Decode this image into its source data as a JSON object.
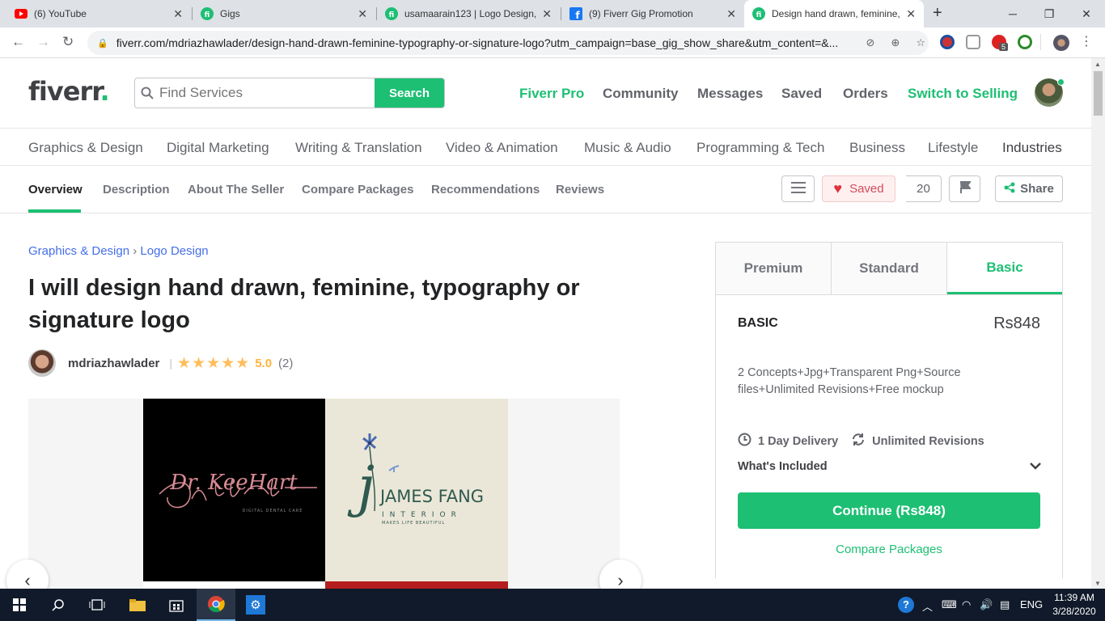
{
  "browser": {
    "tabs": [
      {
        "title": "(6) YouTube",
        "icon": "youtube-icon"
      },
      {
        "title": "Gigs",
        "icon": "fiverr-icon"
      },
      {
        "title": "usamaarain123 | Logo Design,",
        "icon": "fiverr-icon"
      },
      {
        "title": "(9) Fiverr Gig Promotion",
        "icon": "facebook-icon"
      },
      {
        "title": "Design hand drawn, feminine,",
        "icon": "fiverr-icon",
        "active": true
      }
    ],
    "url": "fiverr.com/mdriazhawlader/design-hand-drawn-feminine-typography-or-signature-logo?utm_campaign=base_gig_show_share&utm_content=&...",
    "extension_badge": "5"
  },
  "header": {
    "logo": "fiverr",
    "search_placeholder": "Find Services",
    "search_button": "Search",
    "nav": {
      "pro": "Fiverr Pro",
      "community": "Community",
      "messages": "Messages",
      "saved": "Saved",
      "orders": "Orders",
      "switch": "Switch to Selling"
    }
  },
  "categories": [
    "Graphics & Design",
    "Digital Marketing",
    "Writing & Translation",
    "Video & Animation",
    "Music & Audio",
    "Programming & Tech",
    "Business",
    "Lifestyle",
    "Industries"
  ],
  "subnav": {
    "items": [
      "Overview",
      "Description",
      "About The Seller",
      "Compare Packages",
      "Recommendations",
      "Reviews"
    ],
    "saved_label": "Saved",
    "saved_count": "20",
    "share_label": "Share"
  },
  "gig": {
    "breadcrumb": [
      "Graphics & Design",
      "Logo Design"
    ],
    "breadcrumb_sep": "›",
    "title": "I will design hand drawn, feminine, typography or signature logo",
    "seller": "mdriazhawlader",
    "stars": "★★★★★",
    "rating": "5.0",
    "review_count": "(2)",
    "gallery": {
      "image1_text": "Dr. KeeHart",
      "image1_sub": "DIGITAL DENTAL CARE",
      "image2_title": "JAMES FANG",
      "image2_sub": "INTERIOR",
      "image2_tag": "MAKES LIFE BEAUTIFUL"
    }
  },
  "package": {
    "tabs": [
      "Premium",
      "Standard",
      "Basic"
    ],
    "active_tab": "Basic",
    "name": "BASIC",
    "price": "Rs848",
    "description": "2 Concepts+Jpg+Transparent Png+Source files+Unlimited Revisions+Free mockup",
    "delivery": "1 Day Delivery",
    "revisions": "Unlimited Revisions",
    "included_label": "What's Included",
    "continue_label": "Continue (Rs848)",
    "compare_label": "Compare Packages"
  },
  "taskbar": {
    "language": "ENG",
    "time": "11:39 AM",
    "date": "3/28/2020"
  },
  "colors": {
    "accent": "#1dbf73",
    "link": "#446ee7",
    "star": "#ffbe5b",
    "saved": "#d24b5a"
  }
}
